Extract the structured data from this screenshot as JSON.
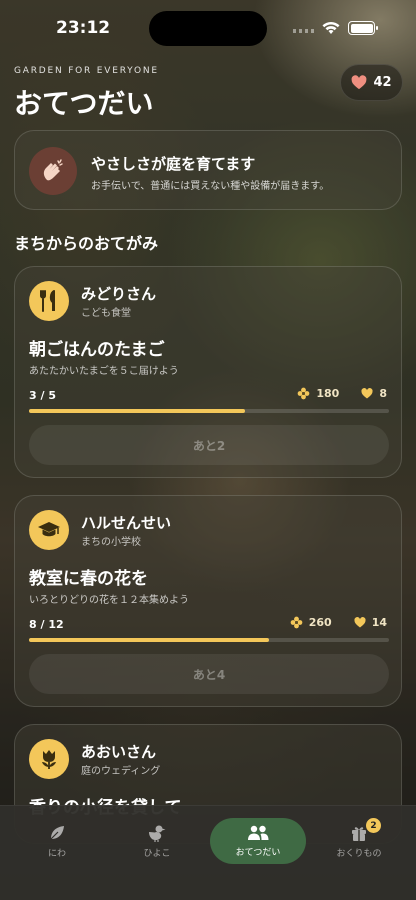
{
  "status_bar": {
    "time": "23:12"
  },
  "header": {
    "eyebrow": "GARDEN FOR EVERYONE",
    "title": "おてつだい",
    "hearts_count": "42",
    "heart_icon": "heart-icon"
  },
  "banner": {
    "icon": "clapping-hands-icon",
    "title": "やさしさが庭を育てます",
    "subtitle": "お手伝いで、普通には買えない種や設備が届きます。"
  },
  "section": {
    "title": "まちからのおてがみ"
  },
  "requests": [
    {
      "icon": "fork-knife-icon",
      "name": "みどりさん",
      "org": "こども食堂",
      "task": "朝ごはんのたまご",
      "description": "あたたかいたまごを５こ届けよう",
      "progress_text": "3 / 5",
      "progress_fraction": 0.6,
      "reward_flowers": "180",
      "reward_hearts": "8",
      "remaining_label": "あと2"
    },
    {
      "icon": "graduation-cap-icon",
      "name": "ハルせんせい",
      "org": "まちの小学校",
      "task": "教室に春の花を",
      "description": "いろとりどりの花を１２本集めよう",
      "progress_text": "8 / 12",
      "progress_fraction": 0.6667,
      "reward_flowers": "260",
      "reward_hearts": "14",
      "remaining_label": "あと4"
    },
    {
      "icon": "tulip-icon",
      "name": "あおいさん",
      "org": "庭のウェディング",
      "task": "香りの小径を貸して"
    }
  ],
  "tabs": [
    {
      "label": "にわ",
      "icon": "leaf-icon",
      "active": false
    },
    {
      "label": "ひよこ",
      "icon": "chick-icon",
      "active": false
    },
    {
      "label": "おてつだい",
      "icon": "people-icon",
      "active": true
    },
    {
      "label": "おくりもの",
      "icon": "gift-icon",
      "active": false,
      "badge": "2"
    }
  ],
  "colors": {
    "accent": "#f3c75a",
    "active_tab": "#3f6a44",
    "heart": "#ef8f80"
  }
}
